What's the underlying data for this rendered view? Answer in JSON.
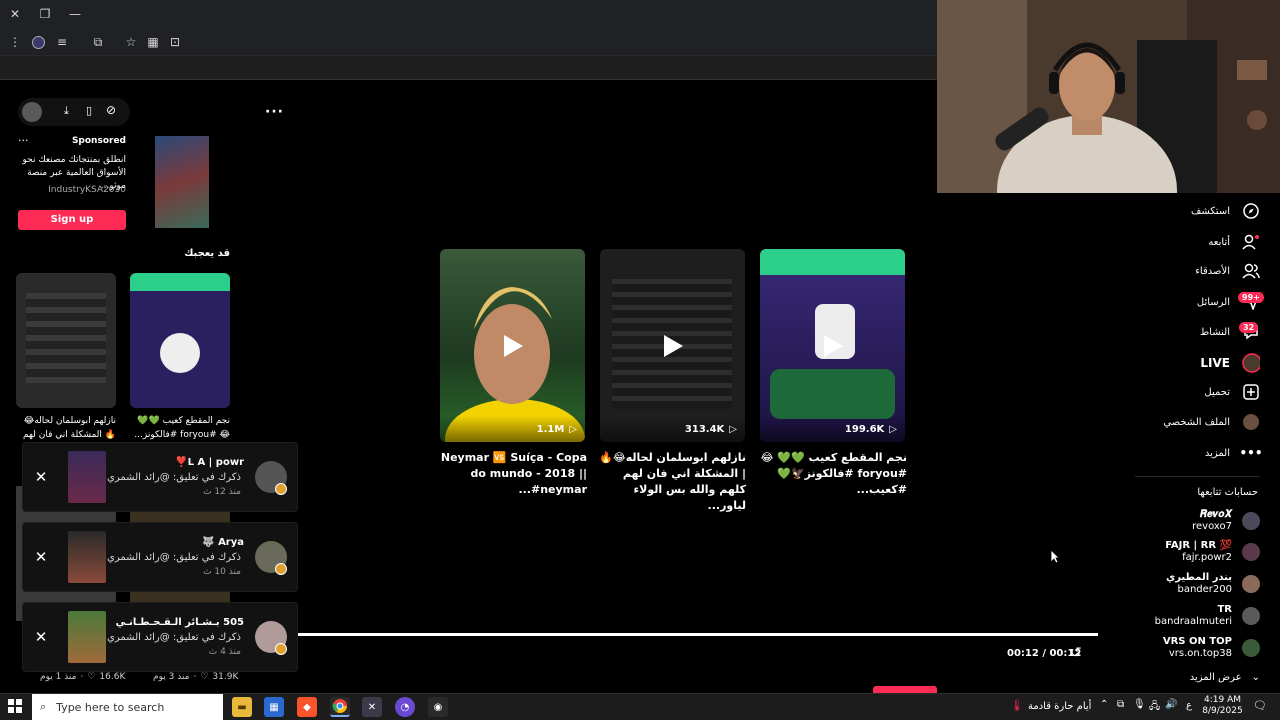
{
  "sponsored": {
    "label": "Sponsored",
    "text": "انطلق بمنتجاتك مصنعك نحو الأسواق العالمية عبر منصة موثو...",
    "account": "IndustryKSA2030",
    "cta": "Sign up"
  },
  "suggested": {
    "heading": "قد يعجبك",
    "items": [
      {
        "caption": "نازلهم ابوسلمان لحاله😂🔥 المشكلة اني فان لهم كلهم والل..."
      },
      {
        "caption": "نجم المقطع كعيب 💚💚 😂 #foryou #فالكونز..."
      }
    ]
  },
  "videos": [
    {
      "views": "1.1M",
      "caption": "Neymar 🆚 Suíça - Copa do mundo - 2018 || #neymar..."
    },
    {
      "views": "313.4K",
      "caption": "نازلهم ابوسلمان لحاله😂🔥 | المشكلة اني فان لهم كلهم والله بس الولاء لياور..."
    },
    {
      "views": "199.6K",
      "caption": "نجم المقطع كعيب 💚💚 😂 #foryou #فالكونز🦅💚 #كعيب..."
    }
  ],
  "player": {
    "time": "00:12 / 00:12"
  },
  "notifications": [
    {
      "name": "L A | powr❣️",
      "text": "ذكرك في تعليق: @رائد الشمري",
      "time": "منذ 12 ث"
    },
    {
      "name": "Arya 🐺",
      "text": "ذكرك في تعليق: @رائد الشمري",
      "time": "منذ 10 ث"
    },
    {
      "name": "505 بـشـائر الـقـحـطـانـي",
      "text": "ذكرك في تعليق: @رائد الشمري",
      "time": "منذ 4 ث"
    }
  ],
  "grid_footer": [
    {
      "likes": "16.6K",
      "age": "منذ 1 يوم"
    },
    {
      "likes": "31.9K",
      "age": "منذ 3 يوم"
    }
  ],
  "nav": {
    "explore": "استكشف",
    "following": "أتابعه",
    "friends": "الأصدقاء",
    "messages": "الرسائل",
    "messages_badge": "99+",
    "activity": "النشاط",
    "activity_badge": "32",
    "live": "LIVE",
    "upload": "تحميل",
    "profile": "الملف الشخصي",
    "more": "المزيد"
  },
  "following_accounts": {
    "heading": "حسابات تتابعها",
    "accounts": [
      {
        "name": "𝑹𝒆𝒗𝒐𝑿",
        "handle": "revoxo7"
      },
      {
        "name": "FAJR | RR 💯",
        "handle": "fajr.powr2"
      },
      {
        "name": "بندر المطيري",
        "handle": "bander200"
      },
      {
        "name": "TR",
        "handle": "bandraalmuteri"
      },
      {
        "name": "VRS ON TOP",
        "handle": "vrs.on.top38"
      }
    ],
    "see_more": "عرض المزيد"
  },
  "taskbar": {
    "search_placeholder": "Type here to search",
    "weather": "أيام حارة قادمة",
    "lang": "ع",
    "time": "4:19 AM",
    "date": "8/9/2025"
  },
  "colors": {
    "accent": "#fe2c55",
    "background": "#000000"
  }
}
